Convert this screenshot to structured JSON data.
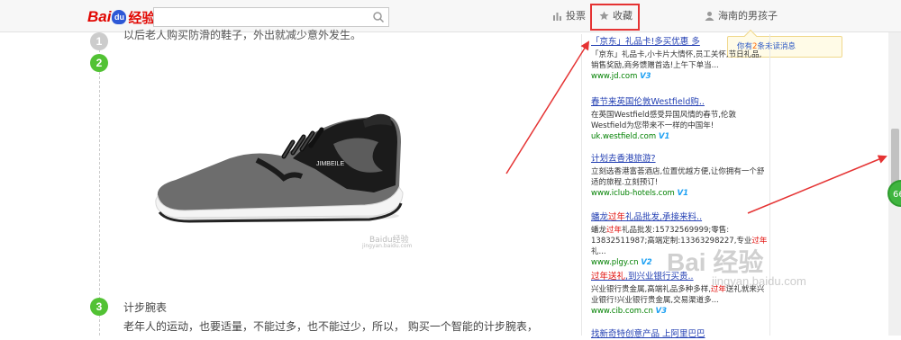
{
  "header": {
    "logo_text_bai": "Bai",
    "logo_paw": "du",
    "logo_text_jy": "经验",
    "search_placeholder": "",
    "vote_label": "投票",
    "favorite_label": "收藏",
    "user_name": "海南的男孩子"
  },
  "notice": {
    "prefix": "你有",
    "count": "2",
    "suffix": "条未读消息"
  },
  "article": {
    "cut_text": "以后老人购买防滑的鞋子，外出就减少意外发生。",
    "steps": [
      "1",
      "2",
      "3"
    ],
    "image_watermark": "Baidu经验",
    "image_watermark_url": "jingyan.baidu.com",
    "step3_title": "计步腕表",
    "step3_body": "老年人的运动，也要适量，不能过多，也不能过少，所以，    购买一个智能的计步腕表，"
  },
  "ads": [
    {
      "title": "「京东」礼品卡!多买优惠 多",
      "desc": "「京东」礼品卡,小卡片大情怀,员工关怀,节日礼品,销售奖励,商务馈赠首选!上午下单当...",
      "url": "www.jd.com",
      "v": "V3"
    },
    {
      "title": "春节来英国伦敦Westfield购..",
      "desc": "在英国Westfield感受异国风情的春节,伦敦Westfield为您带来不一样的中国年!",
      "url": "uk.westfield.com",
      "v": "V1"
    },
    {
      "title": "计划去香港旅游?",
      "desc": "立刻选香港富荟酒店,位置优越方便,让你拥有一个舒适的旅程.立刻预订!",
      "url": "www.iclub-hotels.com",
      "v": "V1"
    },
    {
      "title_pre": "蟠龙",
      "title_hl": "过年",
      "title_post": "礼品批发,承接来料..",
      "desc_pre": "蟠龙",
      "desc_hl": "过年",
      "desc_mid": "礼品批发:15732569999;零售: 13832511987;高端定制:13363298227,专业",
      "desc_hl2": "过年",
      "desc_post": "礼...",
      "url": "www.plgy.cn",
      "v": "V2"
    },
    {
      "title_hl": "过年送礼",
      "title_post": ",到兴业银行买贵..",
      "desc_pre": "兴业银行贵金属,高端礼品多种多样,",
      "desc_hl": "过年",
      "desc_post": "送礼就来兴业银行!兴业银行贵金属,交易渠道多...",
      "url": "www.cib.com.cn",
      "v": "V3"
    },
    {
      "title": "找新奇特创意产品 上阿里巴巴"
    }
  ],
  "side": {
    "badge": "66"
  },
  "watermark": {
    "big": "Bai 经验",
    "url": "jingyan.baidu.com"
  },
  "colors": {
    "annotation_red": "#e53333",
    "step_green": "#52c234",
    "link_blue": "#2440b3"
  }
}
